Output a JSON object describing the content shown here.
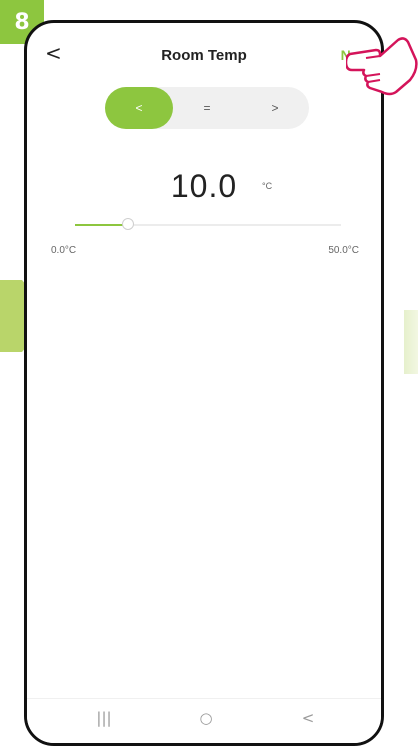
{
  "step": "8",
  "header": {
    "back_glyph": "<",
    "title": "Room Temp",
    "next_label": "Next"
  },
  "segments": [
    {
      "label": "<",
      "active": true
    },
    {
      "label": "=",
      "active": false
    },
    {
      "label": ">",
      "active": false
    }
  ],
  "temperature": {
    "value": "10.0",
    "unit": "°C",
    "min_label": "0.0°C",
    "max_label": "50.0°C",
    "level_fraction": 0.2
  },
  "navbar": {
    "recent_glyph": "|||",
    "home_glyph": "○",
    "back_glyph": "<"
  },
  "colors": {
    "accent": "#8dc63f",
    "hand_outline": "#d4145a"
  },
  "icons": [
    "back-icon",
    "pointing-hand-icon",
    "recent-apps-icon",
    "home-icon",
    "nav-back-icon"
  ]
}
